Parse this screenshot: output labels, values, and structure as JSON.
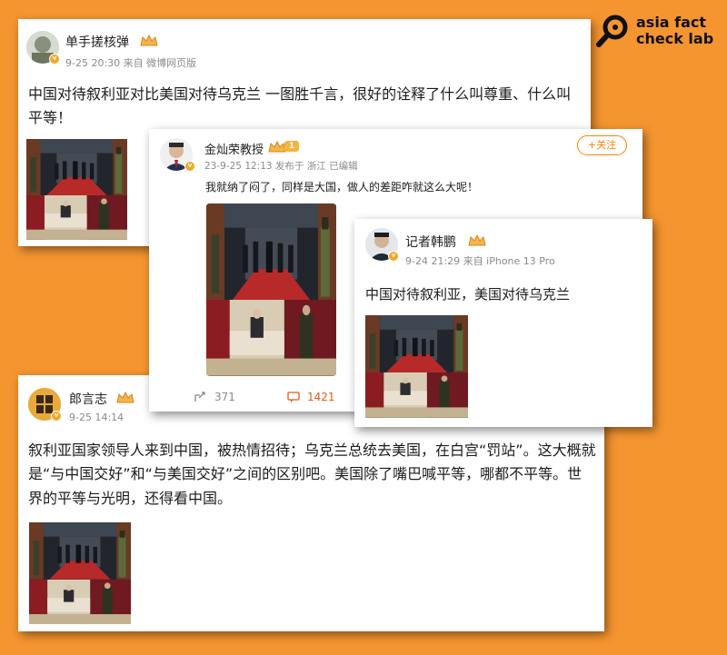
{
  "brand": {
    "line1": "asia fact",
    "line2": "check lab"
  },
  "posts": [
    {
      "user": "单手搓核弹",
      "meta": "9-25 20:30 来自 微博网页版",
      "text": "中国对待叙利亚对比美国对待乌克兰 一图胜千言，很好的诠释了什么叫尊重、什么叫平等！"
    },
    {
      "user": "金灿荣教授",
      "level": "1",
      "meta": "23-9-25 12:13 发布于 浙江  已编辑",
      "follow": "+关注",
      "text": "我就纳了闷了，同样是大国，做人的差距咋就这么大呢！",
      "shares": "371",
      "comments": "1421"
    },
    {
      "user": "记者韩鹏",
      "meta": "9-24 21:29 来自 iPhone 13 Pro",
      "text": "中国对待叙利亚，美国对待乌克兰"
    },
    {
      "user": "郎言志",
      "meta": "9-25 14:14",
      "text": "叙利亚国家领导人来到中国，被热情招待；乌克兰总统去美国，在白宫“罚站”。这大概就是“与中国交好”和“与美国交好”之间的区别吧。美国除了嘴巴喊平等，哪都不平等。世界的平等与光明，还得看中国。"
    }
  ]
}
